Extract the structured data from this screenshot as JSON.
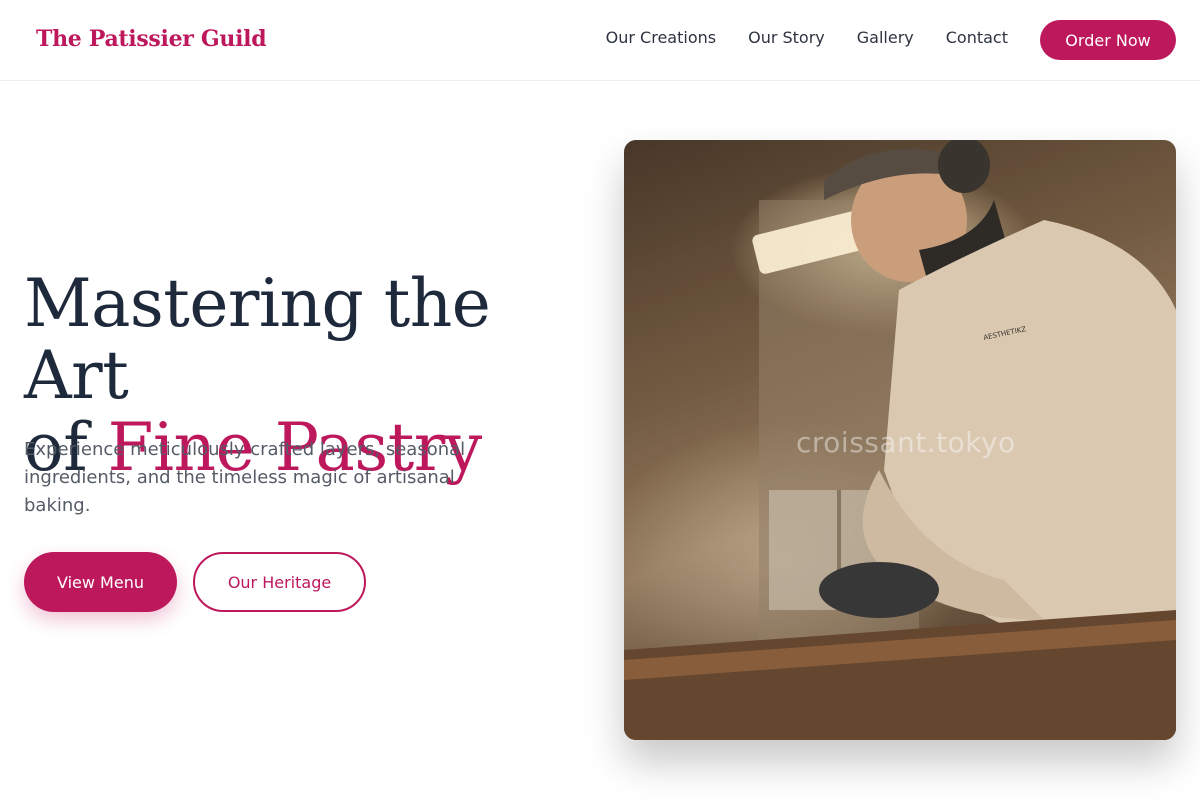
{
  "brand": {
    "name": "The Patissier Guild"
  },
  "nav": {
    "items": [
      {
        "label": "Our Creations"
      },
      {
        "label": "Our Story"
      },
      {
        "label": "Gallery"
      },
      {
        "label": "Contact"
      }
    ],
    "cta_label": "Order Now"
  },
  "hero": {
    "title_line1": "Mastering the Art",
    "title_line2_prefix": "of ",
    "title_line2_accent": "Fine Pastry",
    "subtitle": "Experience meticulously crafted layers, seasonal ingredients, and the timeless magic of artisanal baking.",
    "primary_button": "View Menu",
    "secondary_button": "Our Heritage",
    "image_watermark": "croissant.tokyo",
    "image_alt": "baker-photo"
  },
  "colors": {
    "accent": "#be185d",
    "heading": "#1e293b",
    "body_text": "#555b66"
  }
}
